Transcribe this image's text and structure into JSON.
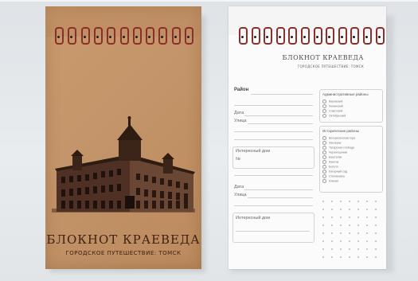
{
  "cover": {
    "title": "БЛОКНОТ КРАЕВЕДА",
    "subtitle": "ГОРОДСКОЕ ПУТЕШЕСТВИЕ: ТОМСК"
  },
  "page": {
    "title": "БЛОКНОТ КРАЕВЕДА",
    "subtitle": "ГОРОДСКОЕ ПУТЕШЕСТВИЕ: ТОМСК",
    "left": {
      "district": "Район",
      "date1": "Дата",
      "street1": "Улица",
      "interesting1": "Интересный дом",
      "note1": "№",
      "date2": "Дата",
      "street2": "Улица",
      "interesting2": "Интересный дом"
    },
    "admin_title": "Административные районы",
    "admin": [
      "Кировский",
      "Ленинский",
      "Советский",
      "Октябрьский"
    ],
    "hist_title": "Исторические районы",
    "hist": [
      "Воскресенская гора",
      "Заозерье",
      "Татарская слобода",
      "Черемошники",
      "Кашталак",
      "Каштак",
      "Болото",
      "Лагерный сад",
      "Степановка",
      "Южная"
    ]
  },
  "accents": {
    "cover": "#c4956a",
    "text": "#3d1f12",
    "spiral": "#8a2f2a"
  }
}
